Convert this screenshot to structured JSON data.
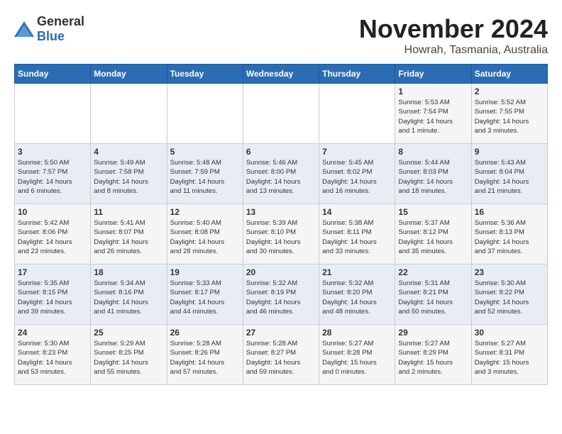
{
  "logo": {
    "general": "General",
    "blue": "Blue"
  },
  "title": "November 2024",
  "subtitle": "Howrah, Tasmania, Australia",
  "days_of_week": [
    "Sunday",
    "Monday",
    "Tuesday",
    "Wednesday",
    "Thursday",
    "Friday",
    "Saturday"
  ],
  "weeks": [
    [
      {
        "day": "",
        "info": ""
      },
      {
        "day": "",
        "info": ""
      },
      {
        "day": "",
        "info": ""
      },
      {
        "day": "",
        "info": ""
      },
      {
        "day": "",
        "info": ""
      },
      {
        "day": "1",
        "info": "Sunrise: 5:53 AM\nSunset: 7:54 PM\nDaylight: 14 hours\nand 1 minute."
      },
      {
        "day": "2",
        "info": "Sunrise: 5:52 AM\nSunset: 7:55 PM\nDaylight: 14 hours\nand 3 minutes."
      }
    ],
    [
      {
        "day": "3",
        "info": "Sunrise: 5:50 AM\nSunset: 7:57 PM\nDaylight: 14 hours\nand 6 minutes."
      },
      {
        "day": "4",
        "info": "Sunrise: 5:49 AM\nSunset: 7:58 PM\nDaylight: 14 hours\nand 8 minutes."
      },
      {
        "day": "5",
        "info": "Sunrise: 5:48 AM\nSunset: 7:59 PM\nDaylight: 14 hours\nand 11 minutes."
      },
      {
        "day": "6",
        "info": "Sunrise: 5:46 AM\nSunset: 8:00 PM\nDaylight: 14 hours\nand 13 minutes."
      },
      {
        "day": "7",
        "info": "Sunrise: 5:45 AM\nSunset: 8:02 PM\nDaylight: 14 hours\nand 16 minutes."
      },
      {
        "day": "8",
        "info": "Sunrise: 5:44 AM\nSunset: 8:03 PM\nDaylight: 14 hours\nand 18 minutes."
      },
      {
        "day": "9",
        "info": "Sunrise: 5:43 AM\nSunset: 8:04 PM\nDaylight: 14 hours\nand 21 minutes."
      }
    ],
    [
      {
        "day": "10",
        "info": "Sunrise: 5:42 AM\nSunset: 8:06 PM\nDaylight: 14 hours\nand 23 minutes."
      },
      {
        "day": "11",
        "info": "Sunrise: 5:41 AM\nSunset: 8:07 PM\nDaylight: 14 hours\nand 26 minutes."
      },
      {
        "day": "12",
        "info": "Sunrise: 5:40 AM\nSunset: 8:08 PM\nDaylight: 14 hours\nand 28 minutes."
      },
      {
        "day": "13",
        "info": "Sunrise: 5:39 AM\nSunset: 8:10 PM\nDaylight: 14 hours\nand 30 minutes."
      },
      {
        "day": "14",
        "info": "Sunrise: 5:38 AM\nSunset: 8:11 PM\nDaylight: 14 hours\nand 33 minutes."
      },
      {
        "day": "15",
        "info": "Sunrise: 5:37 AM\nSunset: 8:12 PM\nDaylight: 14 hours\nand 35 minutes."
      },
      {
        "day": "16",
        "info": "Sunrise: 5:36 AM\nSunset: 8:13 PM\nDaylight: 14 hours\nand 37 minutes."
      }
    ],
    [
      {
        "day": "17",
        "info": "Sunrise: 5:35 AM\nSunset: 8:15 PM\nDaylight: 14 hours\nand 39 minutes."
      },
      {
        "day": "18",
        "info": "Sunrise: 5:34 AM\nSunset: 8:16 PM\nDaylight: 14 hours\nand 41 minutes."
      },
      {
        "day": "19",
        "info": "Sunrise: 5:33 AM\nSunset: 8:17 PM\nDaylight: 14 hours\nand 44 minutes."
      },
      {
        "day": "20",
        "info": "Sunrise: 5:32 AM\nSunset: 8:19 PM\nDaylight: 14 hours\nand 46 minutes."
      },
      {
        "day": "21",
        "info": "Sunrise: 5:32 AM\nSunset: 8:20 PM\nDaylight: 14 hours\nand 48 minutes."
      },
      {
        "day": "22",
        "info": "Sunrise: 5:31 AM\nSunset: 8:21 PM\nDaylight: 14 hours\nand 50 minutes."
      },
      {
        "day": "23",
        "info": "Sunrise: 5:30 AM\nSunset: 8:22 PM\nDaylight: 14 hours\nand 52 minutes."
      }
    ],
    [
      {
        "day": "24",
        "info": "Sunrise: 5:30 AM\nSunset: 8:23 PM\nDaylight: 14 hours\nand 53 minutes."
      },
      {
        "day": "25",
        "info": "Sunrise: 5:29 AM\nSunset: 8:25 PM\nDaylight: 14 hours\nand 55 minutes."
      },
      {
        "day": "26",
        "info": "Sunrise: 5:28 AM\nSunset: 8:26 PM\nDaylight: 14 hours\nand 57 minutes."
      },
      {
        "day": "27",
        "info": "Sunrise: 5:28 AM\nSunset: 8:27 PM\nDaylight: 14 hours\nand 59 minutes."
      },
      {
        "day": "28",
        "info": "Sunrise: 5:27 AM\nSunset: 8:28 PM\nDaylight: 15 hours\nand 0 minutes."
      },
      {
        "day": "29",
        "info": "Sunrise: 5:27 AM\nSunset: 8:29 PM\nDaylight: 15 hours\nand 2 minutes."
      },
      {
        "day": "30",
        "info": "Sunrise: 5:27 AM\nSunset: 8:31 PM\nDaylight: 15 hours\nand 3 minutes."
      }
    ]
  ]
}
